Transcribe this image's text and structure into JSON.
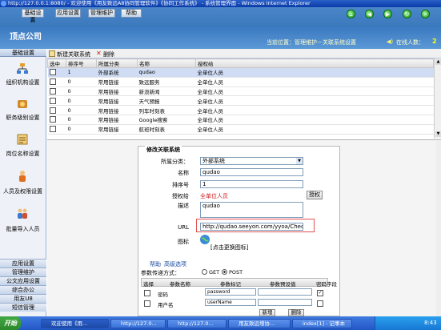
{
  "window": {
    "title": "http://127.0.0.1:8080/ - 欢迎使用《用友致远A8协同管理软件》《协同工作系统》 - 系统管理界面 - Windows Internet Explorer"
  },
  "header": {
    "menus": [
      "基础设置",
      "应用设置",
      "管理维护",
      "帮助"
    ],
    "company": "顶点公司",
    "location": "当前位置：管理维护－关联系统设置",
    "online_label": "在线人数：",
    "online_count": "2"
  },
  "sidebar": {
    "top": "基础设置",
    "items": [
      "组织机构设置",
      "职务级别设置",
      "岗位名称设置",
      "人员及权限设置",
      "批量导入人员"
    ],
    "bottom": [
      "应用设置",
      "管理维护",
      "公文应用设置",
      "综合办公",
      "用友U8",
      "短信管理"
    ]
  },
  "toolbar": {
    "new": "新建关联系统",
    "delete": "删除"
  },
  "grid": {
    "headers": [
      "选中",
      "排序号",
      "所属分类",
      "名称",
      "授权给"
    ],
    "rows": [
      [
        "1",
        "外部系统",
        "qudao",
        "全单位人员"
      ],
      [
        "0",
        "常用链接",
        "致远服务",
        "全单位人员"
      ],
      [
        "0",
        "常用链接",
        "新浪新闻",
        "全单位人员"
      ],
      [
        "0",
        "常用链接",
        "天气预报",
        "全单位人员"
      ],
      [
        "0",
        "常用链接",
        "列车时刻表",
        "全单位人员"
      ],
      [
        "0",
        "常用链接",
        "Google搜索",
        "全单位人员"
      ],
      [
        "0",
        "常用链接",
        "航班时刻表",
        "全单位人员"
      ]
    ]
  },
  "form": {
    "title": "修改关联系统",
    "category_label": "所属分类：",
    "category_value": "外部系统",
    "name_label": "名称",
    "name_value": "qudao",
    "order_label": "排序号",
    "order_value": "1",
    "grant_label": "授权给",
    "grant_value": "全单位人员",
    "grant_button": "授权",
    "desc_label": "描述",
    "desc_value": "qudao",
    "url_label": "URL",
    "url_value": "http://qudao.seeyon.com/yyoa/Check",
    "icon_label": "图标",
    "icon_link": "[点击更换图标]",
    "tab_help": "帮助",
    "tab_advanced": "高级选项",
    "method_label": "参数传递方式：",
    "method_get": "GET",
    "method_post": "POST",
    "param_headers": [
      "选择",
      "参数名称",
      "参数标记",
      "参数预设值",
      "密码字段"
    ],
    "params": [
      {
        "name": "密码",
        "mark": "password",
        "value": ""
      },
      {
        "name": "用户名",
        "mark": "userName",
        "value": ""
      }
    ],
    "add_button": "新增",
    "delete_button": "删除"
  },
  "taskbar": {
    "start": "开始",
    "tasks": [
      "欢迎使用《用...",
      "http://127.0...",
      "http://127.0...",
      "用友致远增协...",
      "index[1] - 记事本"
    ],
    "clock": "8:43"
  }
}
